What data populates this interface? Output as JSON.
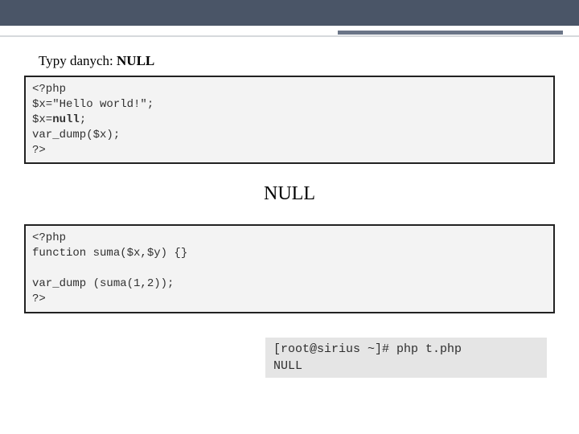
{
  "header": {
    "title_prefix": "Typy danych: ",
    "title_bold": "NULL"
  },
  "code1": {
    "line1": "<?php",
    "line2": "$x=\"Hello world!\";",
    "line3a": "$x=",
    "line3b": "null",
    "line3c": ";",
    "line4": "var_dump($x);",
    "line5": "?>"
  },
  "output1": "NULL",
  "code2": {
    "line1": "<?php",
    "line2": "function suma($x,$y) {}",
    "line3": "",
    "line4": "var_dump (suma(1,2));",
    "line5": "?>"
  },
  "terminal": {
    "line1": "[root@sirius ~]# php t.php",
    "line2": "NULL"
  }
}
